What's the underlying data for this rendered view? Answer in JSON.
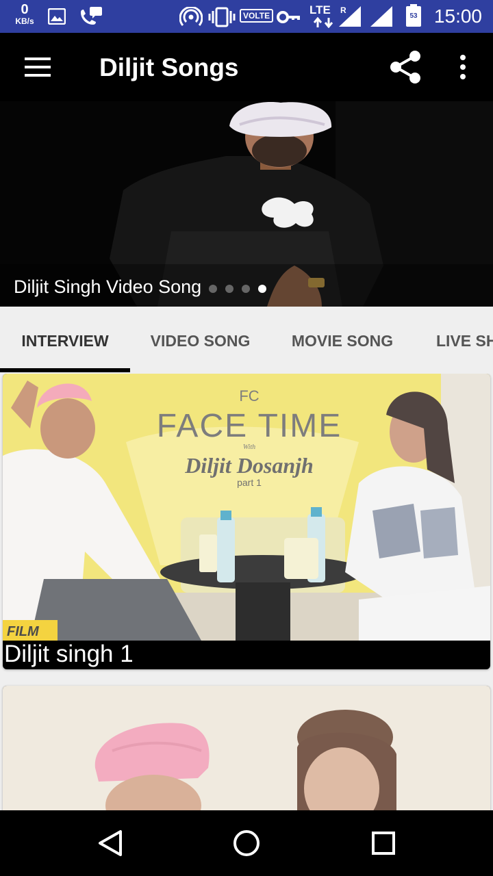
{
  "status_bar": {
    "speed_value": "0",
    "speed_unit": "KB/s",
    "volte": "VOLTE",
    "lte": "LTE",
    "lte_roaming": "R",
    "battery_level": "53",
    "time": "15:00"
  },
  "app_bar": {
    "title": "Diljit Songs",
    "icons": [
      "menu-icon",
      "share-icon",
      "more-vert-icon"
    ]
  },
  "slider": {
    "caption": "Diljit Singh Video Song",
    "slide_count": 4,
    "active_slide": 4
  },
  "tabs": [
    {
      "label": "INTERVIEW",
      "active": true
    },
    {
      "label": "VIDEO SONG",
      "active": false
    },
    {
      "label": "MOVIE SONG",
      "active": false
    },
    {
      "label": "LIVE SH",
      "active": false
    }
  ],
  "videos": [
    {
      "title": "Diljit singh 1",
      "thumbnail_text": {
        "brand": "FC",
        "show": "FACE TIME",
        "with": "With",
        "guest": "Diljit Dosanjh",
        "part": "part 1",
        "corner": "FILM"
      }
    },
    {
      "title": ""
    }
  ],
  "colors": {
    "status_bar": "#2f3fa0",
    "app_bar": "#000000",
    "tab_background": "#efefef",
    "tab_indicator": "#000000"
  },
  "nav": [
    "back-icon",
    "home-icon",
    "recents-icon"
  ]
}
